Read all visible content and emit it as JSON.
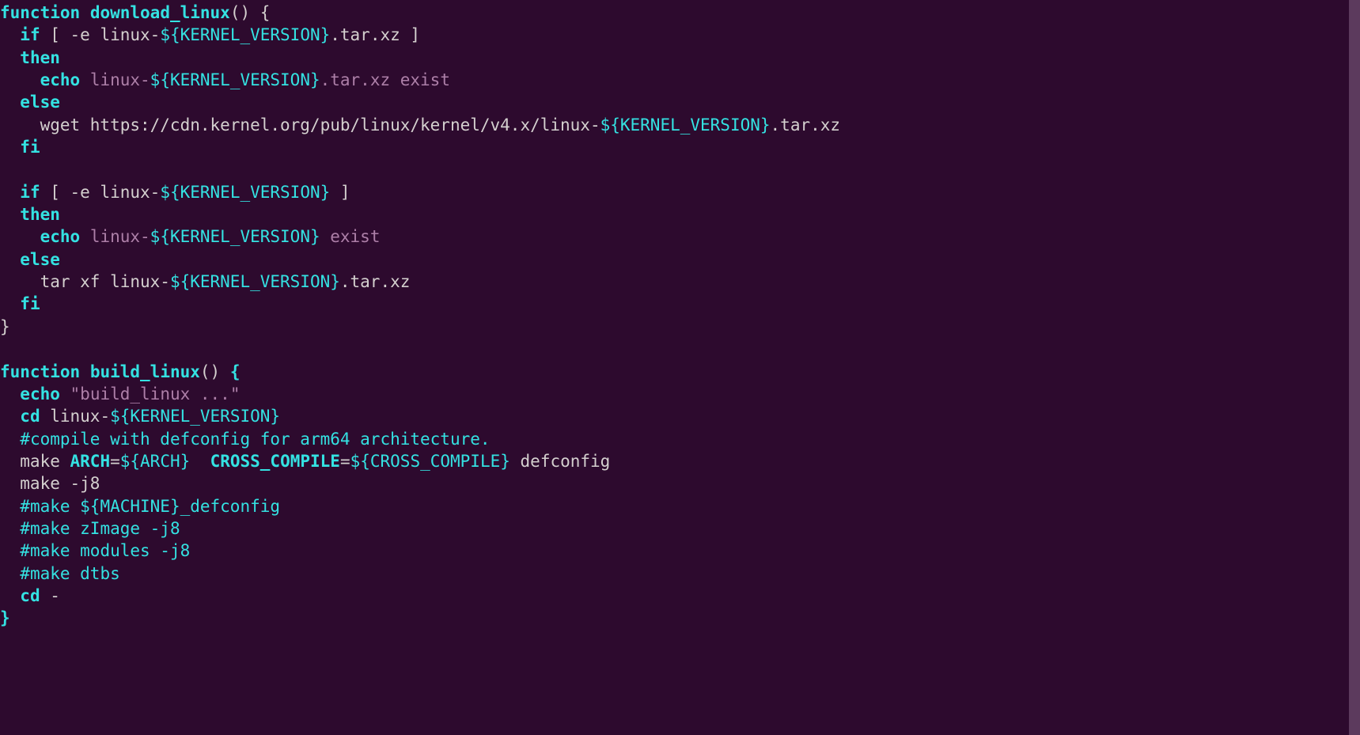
{
  "colors": {
    "bg": "#2d0a2e",
    "fg": "#d4d0cf",
    "keyword": "#34e2e2",
    "string": "#ad7fa8",
    "var": "#34e2e2",
    "comment": "#34e2e2"
  },
  "code": {
    "lines": [
      {
        "segs": [
          {
            "t": "function",
            "c": "kw bold"
          },
          {
            "t": " ",
            "c": ""
          },
          {
            "t": "download_linux",
            "c": "kw bold"
          },
          {
            "t": "() {",
            "c": "cmd"
          }
        ]
      },
      {
        "segs": [
          {
            "t": "  ",
            "c": ""
          },
          {
            "t": "if",
            "c": "kw bold"
          },
          {
            "t": " [ -e linux-",
            "c": "cmd"
          },
          {
            "t": "${KERNEL_VERSION}",
            "c": "var"
          },
          {
            "t": ".tar.xz ]",
            "c": "cmd"
          }
        ]
      },
      {
        "segs": [
          {
            "t": "  ",
            "c": ""
          },
          {
            "t": "then",
            "c": "kw bold"
          }
        ]
      },
      {
        "segs": [
          {
            "t": "    ",
            "c": ""
          },
          {
            "t": "echo",
            "c": "kw bold"
          },
          {
            "t": " ",
            "c": ""
          },
          {
            "t": "linux-",
            "c": "str"
          },
          {
            "t": "${KERNEL_VERSION}",
            "c": "var"
          },
          {
            "t": ".tar.xz exist",
            "c": "str"
          }
        ]
      },
      {
        "segs": [
          {
            "t": "  ",
            "c": ""
          },
          {
            "t": "else",
            "c": "kw bold"
          }
        ]
      },
      {
        "segs": [
          {
            "t": "    wget https://cdn.kernel.org/pub/linux/kernel/v4.x/linux-",
            "c": "cmd"
          },
          {
            "t": "${KERNEL_VERSION}",
            "c": "var"
          },
          {
            "t": ".tar.xz",
            "c": "cmd"
          }
        ]
      },
      {
        "segs": [
          {
            "t": "  ",
            "c": ""
          },
          {
            "t": "fi",
            "c": "kw bold"
          }
        ]
      },
      {
        "segs": [
          {
            "t": " ",
            "c": ""
          }
        ]
      },
      {
        "segs": [
          {
            "t": "  ",
            "c": ""
          },
          {
            "t": "if",
            "c": "kw bold"
          },
          {
            "t": " [ -e linux-",
            "c": "cmd"
          },
          {
            "t": "${KERNEL_VERSION}",
            "c": "var"
          },
          {
            "t": " ]",
            "c": "cmd"
          }
        ]
      },
      {
        "segs": [
          {
            "t": "  ",
            "c": ""
          },
          {
            "t": "then",
            "c": "kw bold"
          }
        ]
      },
      {
        "segs": [
          {
            "t": "    ",
            "c": ""
          },
          {
            "t": "echo",
            "c": "kw bold"
          },
          {
            "t": " ",
            "c": ""
          },
          {
            "t": "linux-",
            "c": "str"
          },
          {
            "t": "${KERNEL_VERSION}",
            "c": "var"
          },
          {
            "t": " exist",
            "c": "str"
          }
        ]
      },
      {
        "segs": [
          {
            "t": "  ",
            "c": ""
          },
          {
            "t": "else",
            "c": "kw bold"
          }
        ]
      },
      {
        "segs": [
          {
            "t": "    tar xf linux-",
            "c": "cmd"
          },
          {
            "t": "${KERNEL_VERSION}",
            "c": "var"
          },
          {
            "t": ".tar.xz",
            "c": "cmd"
          }
        ]
      },
      {
        "segs": [
          {
            "t": "  ",
            "c": ""
          },
          {
            "t": "fi",
            "c": "kw bold"
          }
        ]
      },
      {
        "segs": [
          {
            "t": "}",
            "c": "cmd"
          }
        ]
      },
      {
        "segs": [
          {
            "t": " ",
            "c": ""
          }
        ]
      },
      {
        "segs": [
          {
            "t": "function",
            "c": "kw bold"
          },
          {
            "t": " ",
            "c": ""
          },
          {
            "t": "build_linux",
            "c": "kw bold"
          },
          {
            "t": "() ",
            "c": "cmd"
          },
          {
            "t": "{",
            "c": "kw bold"
          }
        ]
      },
      {
        "segs": [
          {
            "t": "  ",
            "c": ""
          },
          {
            "t": "echo",
            "c": "kw bold"
          },
          {
            "t": " ",
            "c": ""
          },
          {
            "t": "\"build_linux ...\"",
            "c": "str"
          }
        ]
      },
      {
        "segs": [
          {
            "t": "  ",
            "c": ""
          },
          {
            "t": "cd",
            "c": "kw bold"
          },
          {
            "t": " linux-",
            "c": "cmd"
          },
          {
            "t": "${KERNEL_VERSION}",
            "c": "var"
          }
        ]
      },
      {
        "segs": [
          {
            "t": "  ",
            "c": ""
          },
          {
            "t": "#compile with defconfig for arm64 architecture.",
            "c": "cmt"
          }
        ]
      },
      {
        "segs": [
          {
            "t": "  make ",
            "c": "cmd"
          },
          {
            "t": "ARCH",
            "c": "kw bold"
          },
          {
            "t": "=",
            "c": "cmd"
          },
          {
            "t": "${ARCH}",
            "c": "var"
          },
          {
            "t": "  ",
            "c": "cmd"
          },
          {
            "t": "CROSS_COMPILE",
            "c": "kw bold"
          },
          {
            "t": "=",
            "c": "cmd"
          },
          {
            "t": "${CROSS_COMPILE}",
            "c": "var"
          },
          {
            "t": " defconfig",
            "c": "cmd"
          }
        ]
      },
      {
        "segs": [
          {
            "t": "  make -j8",
            "c": "cmd"
          }
        ]
      },
      {
        "segs": [
          {
            "t": "  ",
            "c": ""
          },
          {
            "t": "#make ${MACHINE}_defconfig",
            "c": "cmt"
          }
        ]
      },
      {
        "segs": [
          {
            "t": "  ",
            "c": ""
          },
          {
            "t": "#make zImage -j8",
            "c": "cmt"
          }
        ]
      },
      {
        "segs": [
          {
            "t": "  ",
            "c": ""
          },
          {
            "t": "#make modules -j8",
            "c": "cmt"
          }
        ]
      },
      {
        "segs": [
          {
            "t": "  ",
            "c": ""
          },
          {
            "t": "#make dtbs",
            "c": "cmt"
          }
        ]
      },
      {
        "segs": [
          {
            "t": "  ",
            "c": ""
          },
          {
            "t": "cd",
            "c": "kw bold"
          },
          {
            "t": " -",
            "c": "cmd"
          }
        ]
      },
      {
        "segs": [
          {
            "t": "}",
            "c": "kw bold"
          }
        ]
      }
    ]
  }
}
